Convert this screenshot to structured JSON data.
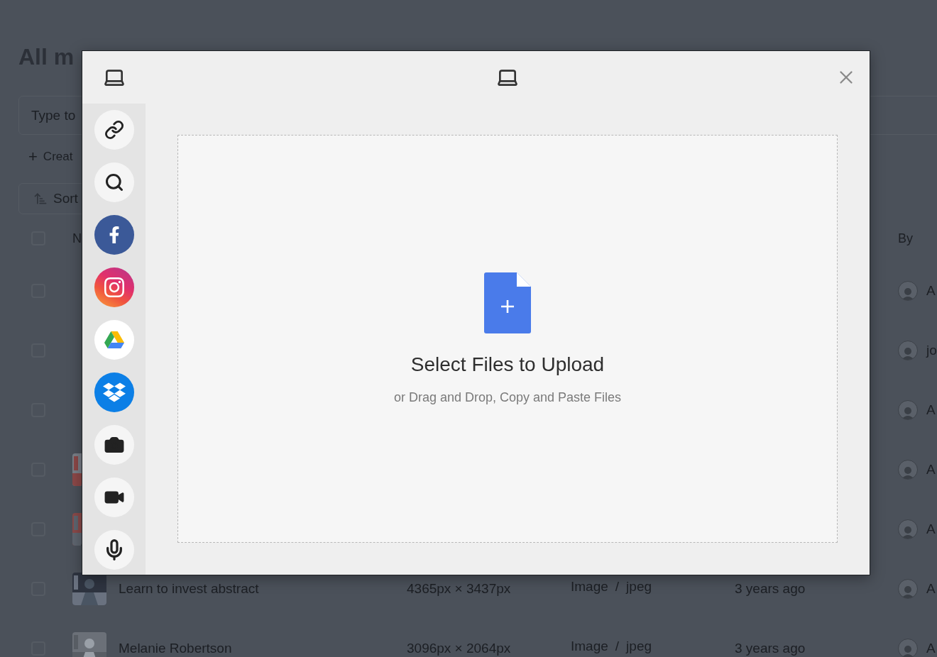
{
  "background": {
    "title": "All m",
    "search": {
      "placeholder": "Type to"
    },
    "create": {
      "icon": "+",
      "label": "Creat"
    },
    "sort": "Sort",
    "header": {
      "checked": false,
      "name": "N",
      "by": "By"
    },
    "rows": [
      {
        "checked": false,
        "thumb": false,
        "by": "A"
      },
      {
        "checked": false,
        "thumb": false,
        "by": "jo"
      },
      {
        "checked": false,
        "thumb": false,
        "by": "A"
      },
      {
        "checked": false,
        "thumb": true,
        "by": "A"
      },
      {
        "checked": false,
        "thumb": true,
        "by": "A"
      },
      {
        "checked": false,
        "thumb": true,
        "name": "Learn to invest abstract",
        "size": "4365px × 3437px",
        "type": "Image",
        "sep": "/",
        "subtype": "jpeg",
        "date": "3 years ago",
        "by": "A"
      },
      {
        "checked": false,
        "thumb": true,
        "name": "Melanie Robertson",
        "size": "3096px × 2064px",
        "type": "Image",
        "sep": "/",
        "subtype": "jpeg",
        "date": "3 years ago",
        "by": "A"
      }
    ]
  },
  "modal": {
    "sources": [
      {
        "kind": "device",
        "selected": true
      },
      {
        "kind": "link",
        "selected": false
      },
      {
        "kind": "search",
        "selected": false
      },
      {
        "kind": "facebook",
        "selected": false
      },
      {
        "kind": "instagram",
        "selected": false
      },
      {
        "kind": "drive",
        "selected": false
      },
      {
        "kind": "dropbox",
        "selected": false
      },
      {
        "kind": "camera",
        "selected": false
      },
      {
        "kind": "video",
        "selected": false
      },
      {
        "kind": "mic",
        "selected": false
      }
    ],
    "drop": {
      "title": "Select Files to Upload",
      "hint": "or Drag and Drop, Copy and Paste Files"
    }
  }
}
